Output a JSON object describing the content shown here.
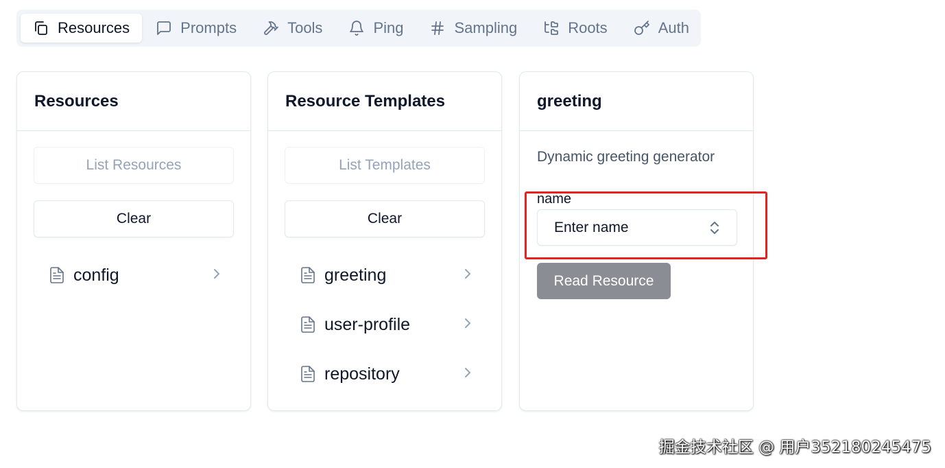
{
  "tabs": [
    {
      "label": "Resources",
      "icon": "copy-icon",
      "active": true
    },
    {
      "label": "Prompts",
      "icon": "message-square-icon",
      "active": false
    },
    {
      "label": "Tools",
      "icon": "hammer-icon",
      "active": false
    },
    {
      "label": "Ping",
      "icon": "bell-icon",
      "active": false
    },
    {
      "label": "Sampling",
      "icon": "hash-icon",
      "active": false
    },
    {
      "label": "Roots",
      "icon": "folder-tree-icon",
      "active": false
    },
    {
      "label": "Auth",
      "icon": "key-icon",
      "active": false
    }
  ],
  "resources_panel": {
    "title": "Resources",
    "list_button": "List Resources",
    "clear_button": "Clear",
    "items": [
      {
        "label": "config"
      }
    ]
  },
  "templates_panel": {
    "title": "Resource Templates",
    "list_button": "List Templates",
    "clear_button": "Clear",
    "items": [
      {
        "label": "greeting"
      },
      {
        "label": "user-profile"
      },
      {
        "label": "repository"
      }
    ]
  },
  "detail_panel": {
    "title": "greeting",
    "description": "Dynamic greeting generator",
    "field_label": "name",
    "field_placeholder": "Enter name",
    "read_button": "Read Resource"
  },
  "colors": {
    "highlight": "#e8231e",
    "read_button_bg": "#8a8d94",
    "tabbar_bg": "#f1f5f9"
  },
  "watermark": "掘金技术社区 @ 用户352180245475"
}
